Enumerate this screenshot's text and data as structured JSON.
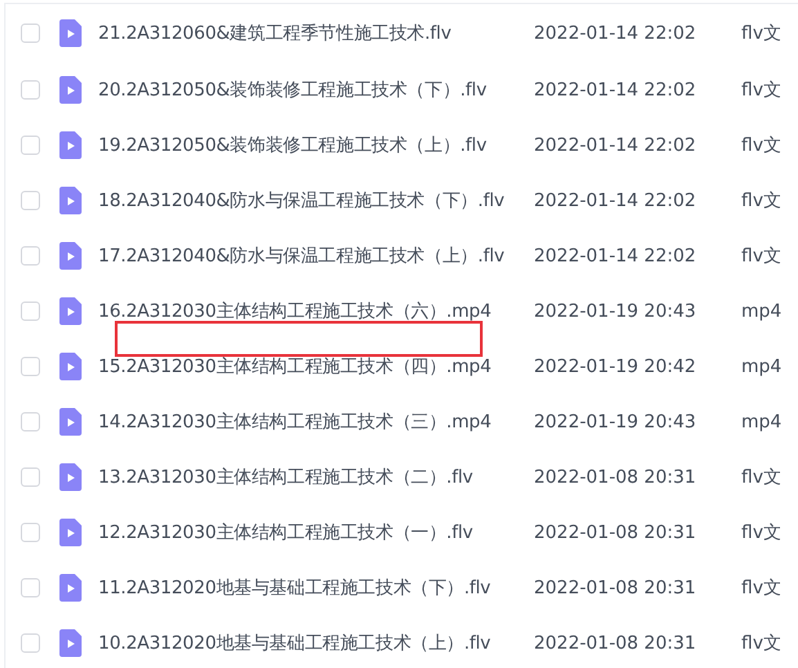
{
  "files": [
    {
      "name": "21.2A312060&建筑工程季节性施工技术.flv",
      "modified": "2022-01-14 22:02",
      "type": "flv文",
      "selected": false
    },
    {
      "name": "20.2A312050&装饰装修工程施工技术（下）.flv",
      "modified": "2022-01-14 22:02",
      "type": "flv文",
      "selected": false
    },
    {
      "name": "19.2A312050&装饰装修工程施工技术（上）.flv",
      "modified": "2022-01-14 22:02",
      "type": "flv文",
      "selected": false
    },
    {
      "name": "18.2A312040&防水与保温工程施工技术（下）.flv",
      "modified": "2022-01-14 22:02",
      "type": "flv文",
      "selected": false
    },
    {
      "name": "17.2A312040&防水与保温工程施工技术（上）.flv",
      "modified": "2022-01-14 22:02",
      "type": "flv文",
      "selected": false
    },
    {
      "name": "16.2A312030主体结构工程施工技术（六）.mp4",
      "modified": "2022-01-19 20:43",
      "type": "mp4",
      "selected": false
    },
    {
      "name": "15.2A312030主体结构工程施工技术（四）.mp4",
      "modified": "2022-01-19 20:42",
      "type": "mp4",
      "selected": false
    },
    {
      "name": "14.2A312030主体结构工程施工技术（三）.mp4",
      "modified": "2022-01-19 20:43",
      "type": "mp4",
      "selected": false
    },
    {
      "name": "13.2A312030主体结构工程施工技术（二）.flv",
      "modified": "2022-01-08 20:31",
      "type": "flv文",
      "selected": false
    },
    {
      "name": "12.2A312030主体结构工程施工技术（一）.flv",
      "modified": "2022-01-08 20:31",
      "type": "flv文",
      "selected": false
    },
    {
      "name": "11.2A312020地基与基础工程施工技术（下）.flv",
      "modified": "2022-01-08 20:31",
      "type": "flv文",
      "selected": false
    },
    {
      "name": "10.2A312020地基与基础工程施工技术（上）.flv",
      "modified": "2022-01-08 20:31",
      "type": "flv文",
      "selected": false
    }
  ],
  "annotations": [
    {
      "kind": "highlight-box"
    }
  ]
}
